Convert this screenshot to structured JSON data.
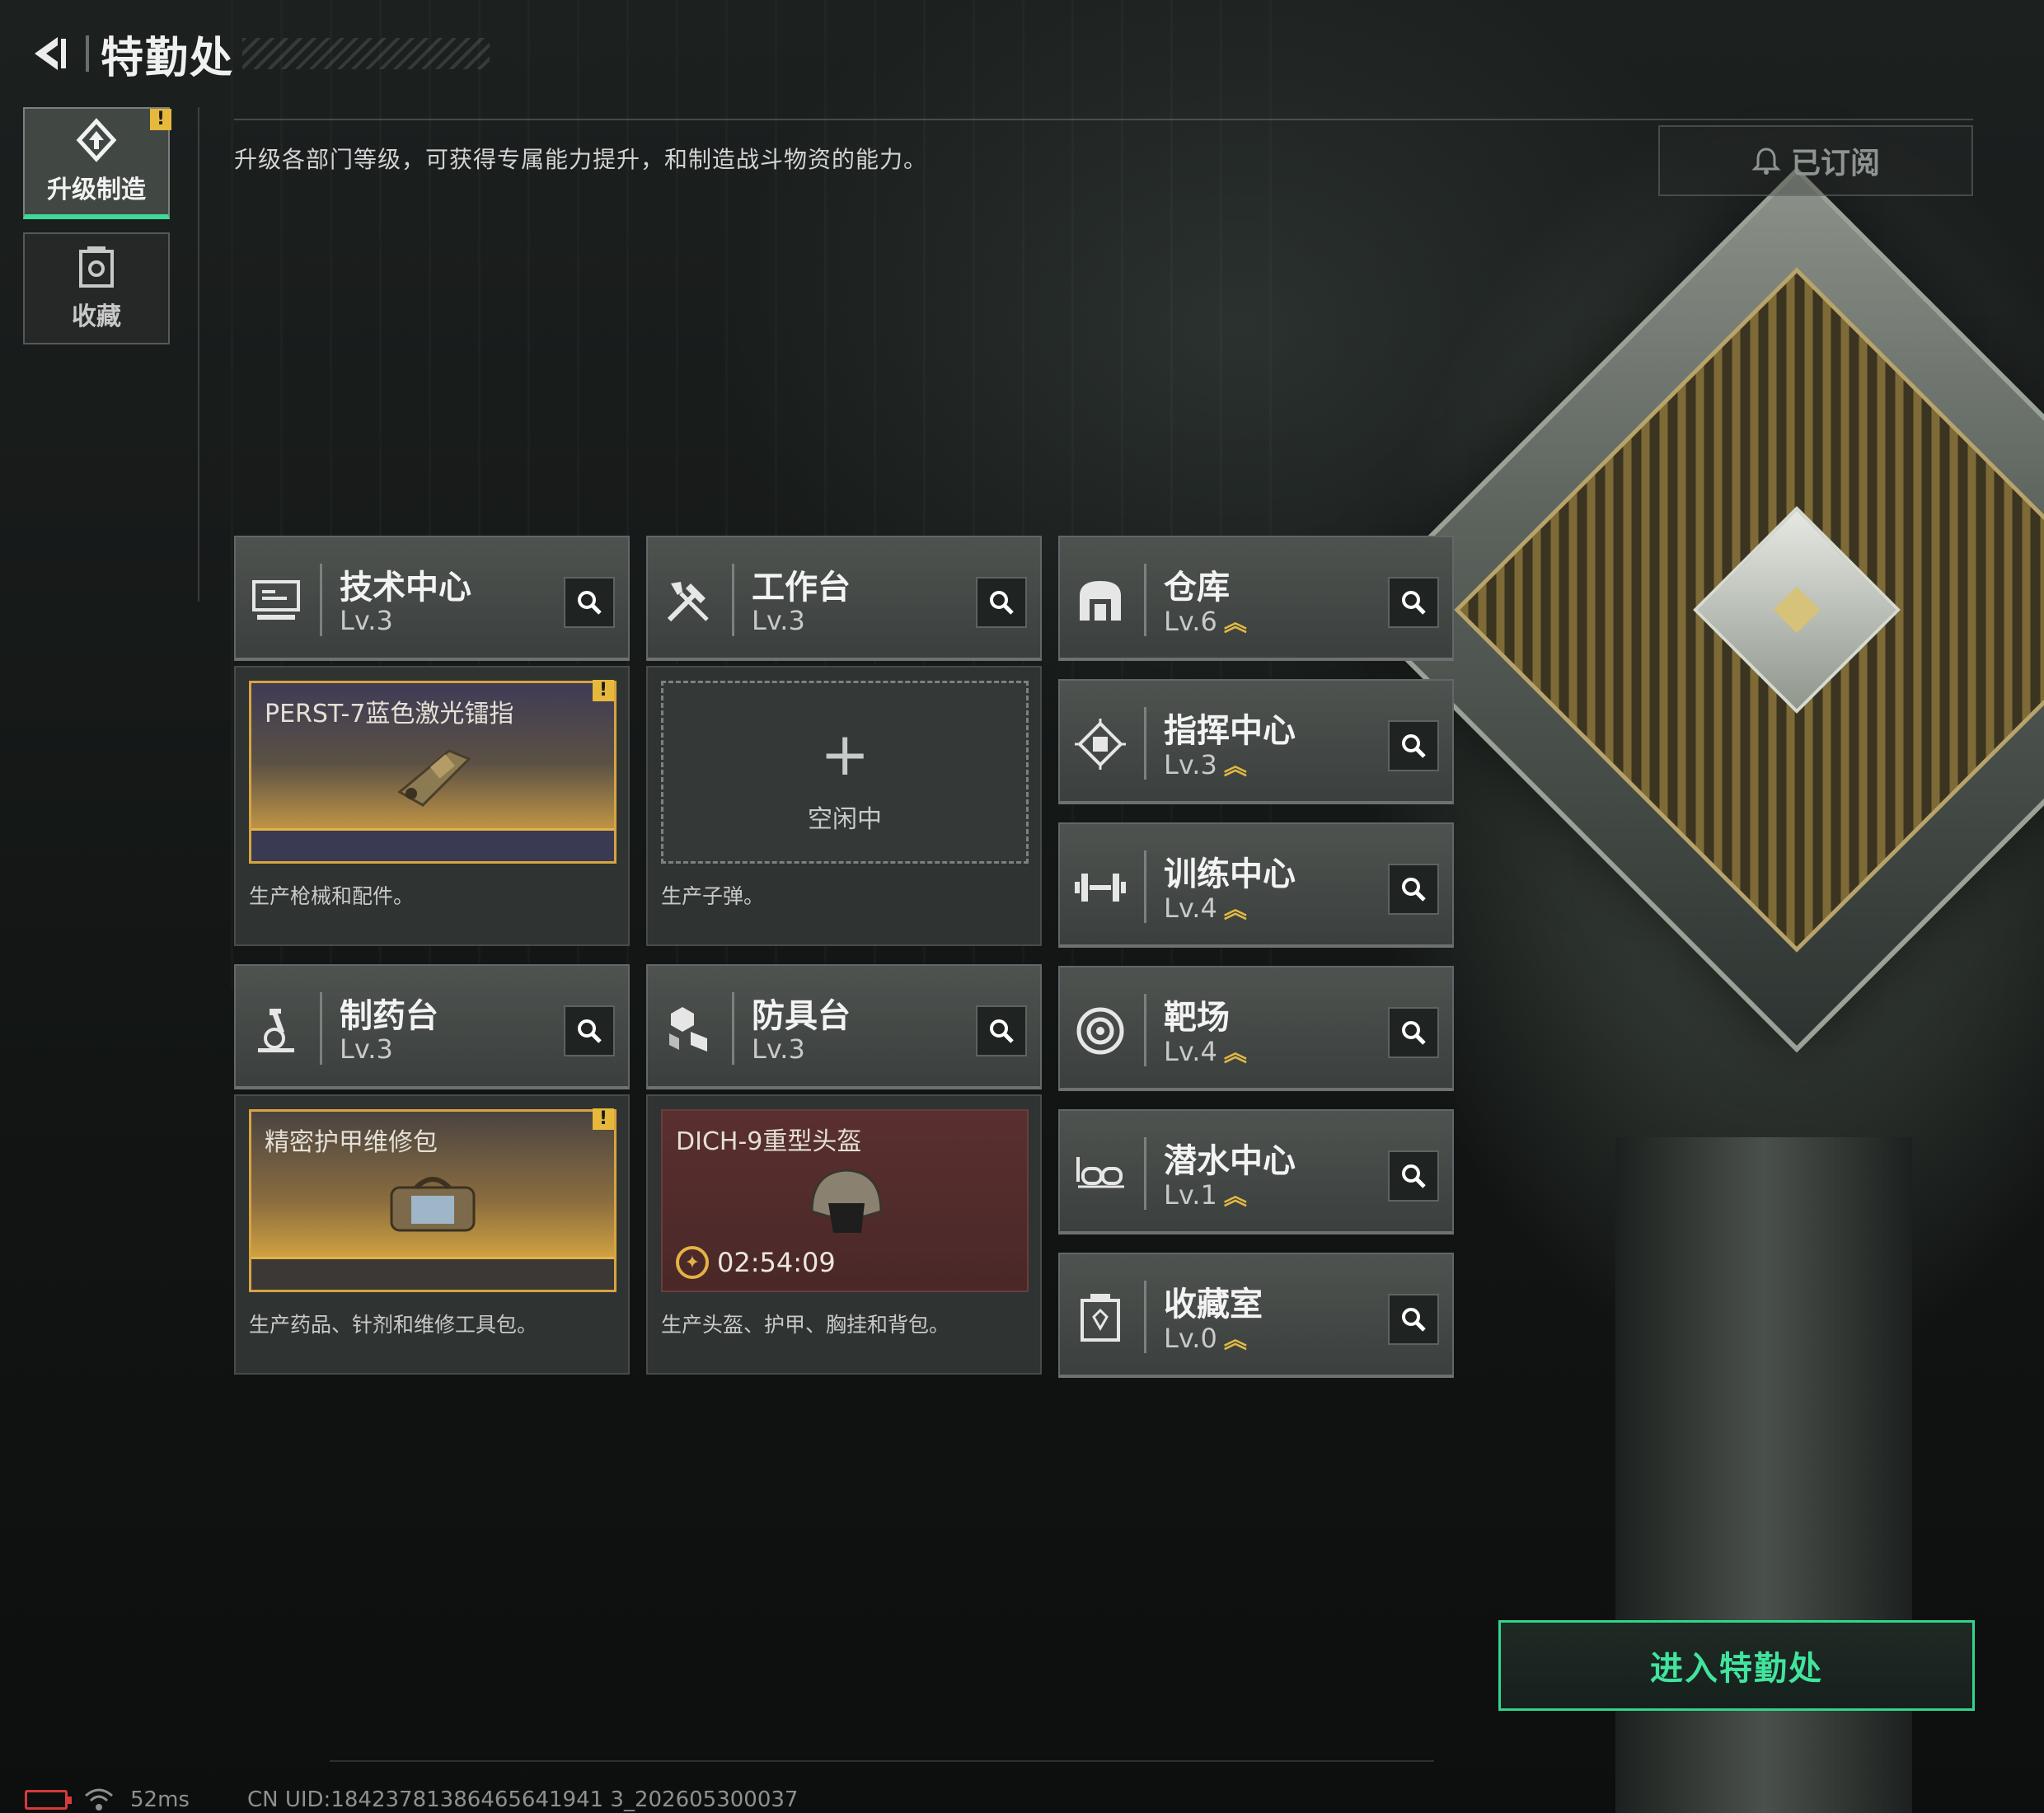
{
  "header": {
    "title": "特勤处"
  },
  "sidenav": [
    {
      "label": "升级制造",
      "active": true,
      "icon": "upgrade-icon",
      "badge": "!"
    },
    {
      "label": "收藏",
      "active": false,
      "icon": "collection-icon"
    }
  ],
  "description": "升级各部门等级，可获得专属能力提升，和制造战斗物资的能力。",
  "subscribed_label": "已订阅",
  "facilities": {
    "tech": {
      "name": "技术中心",
      "level": "Lv.3",
      "icon": "monitor-icon",
      "slot_title": "PERST-7蓝色激光镭指",
      "slot_badge": "!",
      "desc": "生产枪械和配件。"
    },
    "workbench": {
      "name": "工作台",
      "level": "Lv.3",
      "icon": "tools-icon",
      "plus": "+",
      "idle": "空闲中",
      "desc": "生产子弹。"
    },
    "pharmacy": {
      "name": "制药台",
      "level": "Lv.3",
      "icon": "microscope-icon",
      "slot_title": "精密护甲维修包",
      "slot_badge": "!",
      "desc": "生产药品、针剂和维修工具包。"
    },
    "armor": {
      "name": "防具台",
      "level": "Lv.3",
      "icon": "armor-parts-icon",
      "slot_title": "DICH-9重型头盔",
      "timer": "02:54:09",
      "desc": "生产头盔、护甲、胸挂和背包。"
    },
    "warehouse": {
      "name": "仓库",
      "level": "Lv.6",
      "icon": "warehouse-icon",
      "upgrade": "︽"
    },
    "command": {
      "name": "指挥中心",
      "level": "Lv.3",
      "icon": "command-chip-icon",
      "upgrade": "︽"
    },
    "training": {
      "name": "训练中心",
      "level": "Lv.4",
      "icon": "dumbbell-icon",
      "upgrade": "︽"
    },
    "range": {
      "name": "靶场",
      "level": "Lv.4",
      "icon": "target-icon",
      "upgrade": "︽"
    },
    "diving": {
      "name": "潜水中心",
      "level": "Lv.1",
      "icon": "diving-mask-icon",
      "upgrade": "︽"
    },
    "collection": {
      "name": "收藏室",
      "level": "Lv.0",
      "icon": "collection-case-icon",
      "upgrade": "︽"
    }
  },
  "enter_button": "进入特勤处",
  "status": {
    "ping": "52ms",
    "uid": "CN UID:18423781386465641941 3_202605300037"
  },
  "colors": {
    "accent": "#3fd89a",
    "gold": "#e3b944",
    "warning": "#e6b93c"
  }
}
